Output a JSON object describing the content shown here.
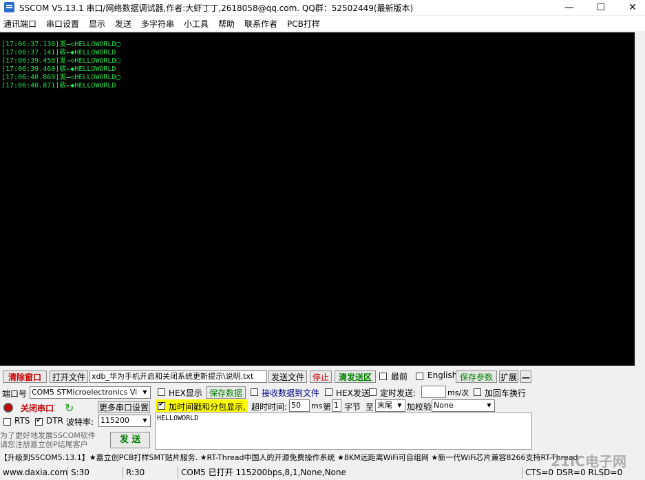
{
  "window": {
    "title": "SSCOM V5.13.1 串口/网络数据调试器,作者:大虾丁丁,2618058@qq.com. QQ群：52502449(最新版本)",
    "minimize": "—",
    "maximize": "☐",
    "close": "✕"
  },
  "menu": [
    "通讯端口",
    "串口设置",
    "显示",
    "发送",
    "多字符串",
    "小工具",
    "帮助",
    "联系作者",
    "PCB打样"
  ],
  "console": {
    "lines": [
      "[17:06:37.138]发→◇HELLOWORLD□",
      "[17:06:37.141]收←◆HELLOWORLD",
      "[17:06:39.458]发→◇HELLOWORLD□",
      "[17:06:39.460]收←◆HELLOWORLD",
      "[17:06:40.869]发→◇HELLOWORLD□",
      "[17:06:40.871]收←◆HELLOWORLD"
    ]
  },
  "toolbar": {
    "clear": "清除窗口",
    "open_file": "打开文件",
    "file_path": "xdb_华为手机开启和关闭系统更新提示\\说明.txt",
    "send_file": "发送文件",
    "stop": "停止",
    "clear_send": "清发送区",
    "top": "最前",
    "english": "English",
    "save_params": "保存参数",
    "expand": "扩展",
    "collapse": "—"
  },
  "port": {
    "label": "端口号",
    "value": "COM5 STMicroelectronics Vi",
    "close_port": "关闭串口",
    "more_settings": "更多串口设置",
    "rts": "RTS",
    "dtr": "DTR",
    "baud_label": "波特率:",
    "baud": "115200"
  },
  "options": {
    "hex_display": "HEX显示",
    "save_data": "保存数据",
    "recv_to_file": "接收数据到文件",
    "hex_send": "HEX发送",
    "timed_send": "定时发送:",
    "ms_per": "ms/次",
    "add_crlf": "加回车换行",
    "timestamp": "加时间戳和分包显示,",
    "timeout_label": "超时时间:",
    "timeout": "50",
    "ms": "ms",
    "byte_label_1": "第",
    "byte_num": "1",
    "byte_label_2": "字节",
    "to": "至",
    "to_value": "末尾",
    "checksum_label": "加校验",
    "checksum": "None"
  },
  "promo": {
    "line1": "为了更好地发展SSCOM软件",
    "line2": "请您注册嘉立创P结尾客户"
  },
  "send": {
    "button": "发 送",
    "text": "HELLOWORLD"
  },
  "ticker": "【升级到SSCOM5.13.1】★嘉立创PCB打样SMT贴片服务. ★RT-Thread中国人的开源免费操作系统 ★8KM远距离WiFi可自组网 ★新一代WiFi芯片兼容8266支持RT-Thread",
  "status": {
    "site": "www.daxia.com",
    "sent": "S:30",
    "recv": "R:30",
    "port_state": "COM5 已打开  115200bps,8,1,None,None",
    "lines": "CTS=0 DSR=0 RLSD=0"
  },
  "watermark": "21IC电子网"
}
